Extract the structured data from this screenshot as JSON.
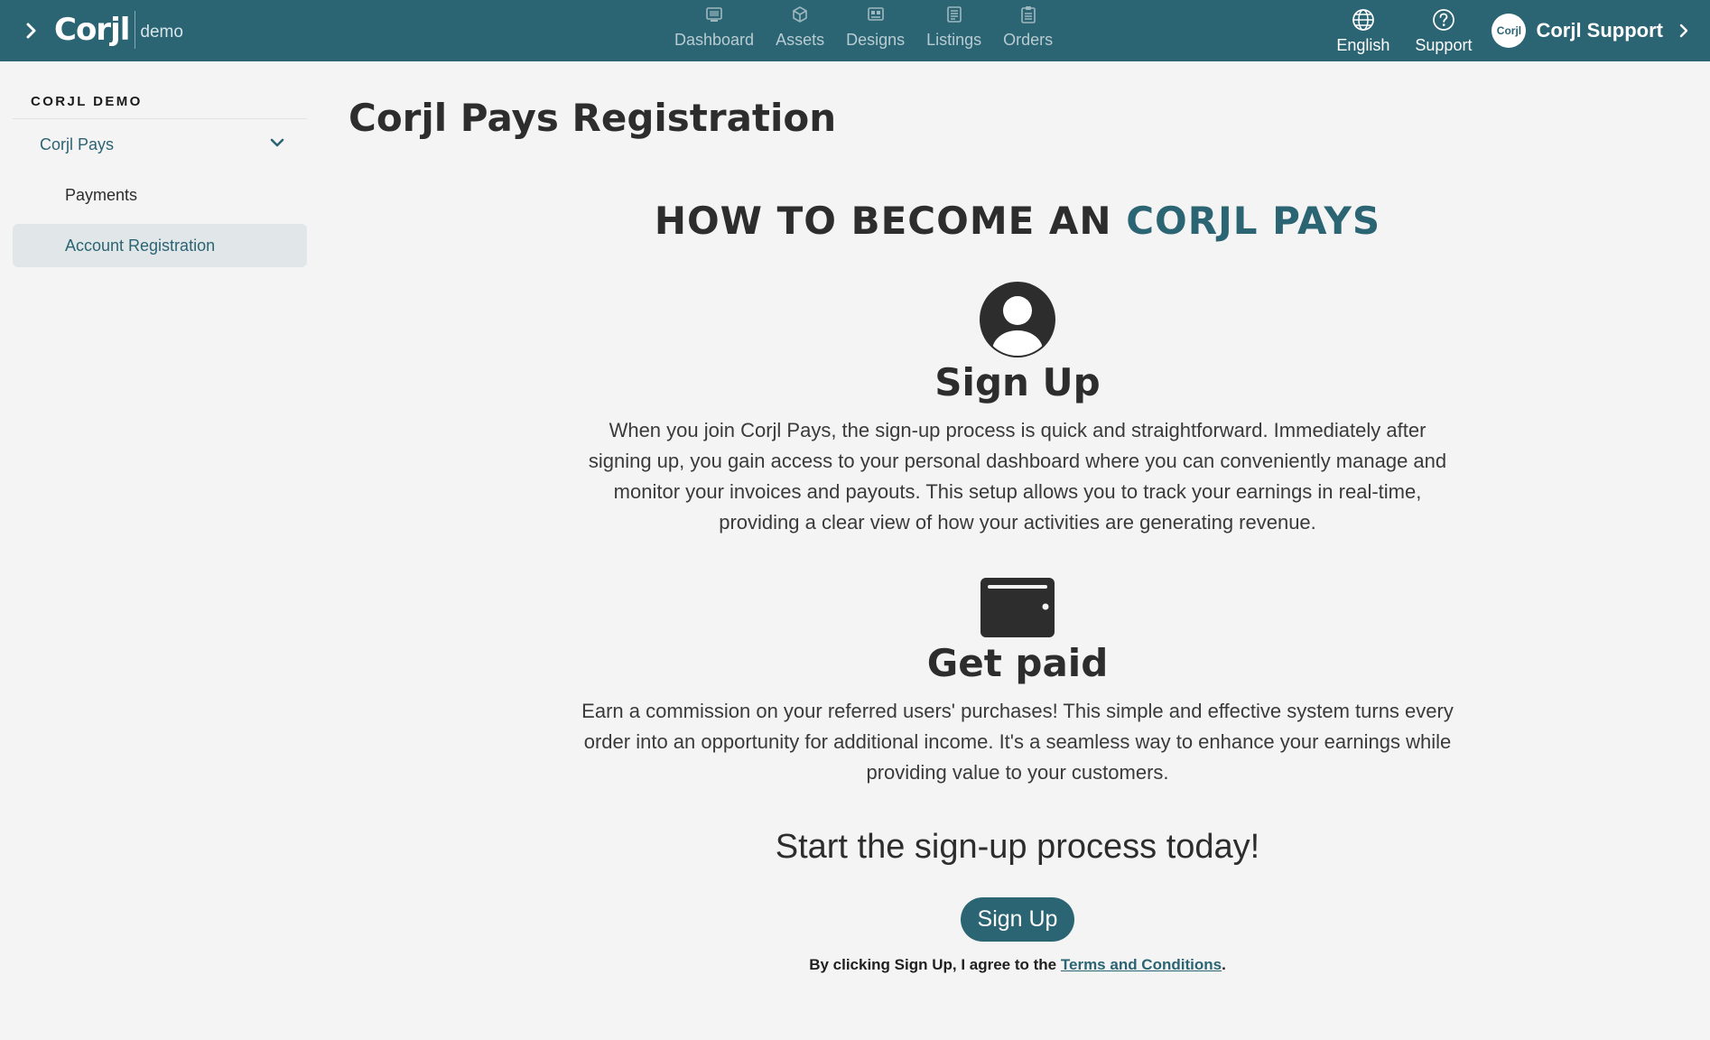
{
  "header": {
    "logo": "Corjl",
    "logo_sub": "demo",
    "nav": [
      {
        "label": "Dashboard",
        "icon": "dashboard-icon"
      },
      {
        "label": "Assets",
        "icon": "cube-icon"
      },
      {
        "label": "Designs",
        "icon": "designs-icon"
      },
      {
        "label": "Listings",
        "icon": "list-icon"
      },
      {
        "label": "Orders",
        "icon": "clipboard-icon"
      }
    ],
    "language_label": "English",
    "support_label": "Support",
    "account_avatar_text": "Corjl",
    "account_name": "Corjl Support"
  },
  "sidebar": {
    "title": "CORJL DEMO",
    "items": [
      {
        "label": "Corjl Pays"
      },
      {
        "label": "Payments"
      },
      {
        "label": "Account Registration"
      }
    ]
  },
  "main": {
    "page_title": "Corjl Pays Registration",
    "hero_prefix": "HOW TO BECOME AN",
    "hero_accent": "CORJL PAYS",
    "steps": [
      {
        "title": "Sign Up",
        "icon": "user-circle-icon",
        "text": "When you join Corjl Pays, the sign-up process is quick and straightforward. Immediately after signing up, you gain access to your personal dashboard where you can conveniently manage and monitor your invoices and payouts. This setup allows you to track your earnings in real-time, providing a clear view of how your activities are generating revenue."
      },
      {
        "title": "Get paid",
        "icon": "wallet-icon",
        "text": "Earn a commission on your referred users' purchases! This simple and effective system turns every order into an opportunity for additional income. It's a seamless way to enhance your earnings while providing value to your customers."
      }
    ],
    "cta": "Start the sign-up process today!",
    "signup_button": "Sign Up",
    "agree_prefix": "By clicking Sign Up, I agree to the",
    "terms_link": "Terms and Conditions",
    "agree_suffix": "."
  },
  "colors": {
    "brand": "#2b6473",
    "background": "#f4f4f4",
    "text": "#2d2d2d"
  }
}
